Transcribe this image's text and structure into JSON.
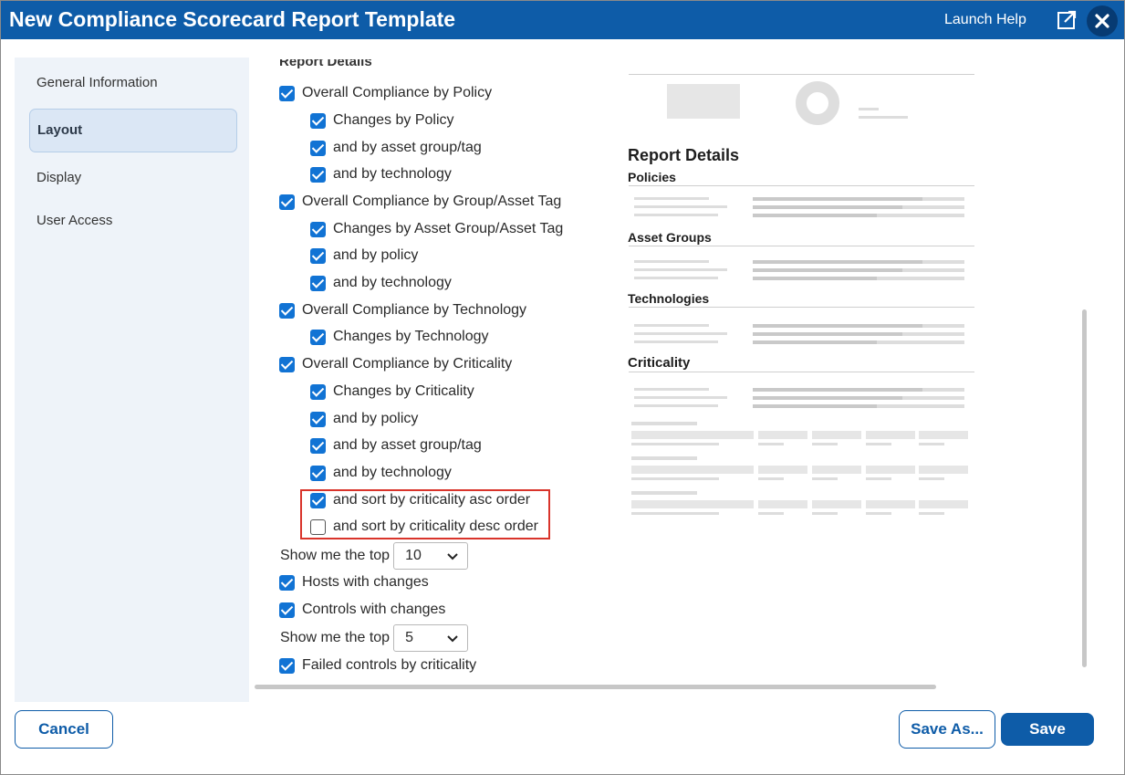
{
  "window": {
    "title": "New Compliance Scorecard Report Template",
    "help_link": "Launch Help"
  },
  "sidebar": {
    "items": [
      {
        "label": "General Information"
      },
      {
        "label": "Layout"
      },
      {
        "label": "Display"
      },
      {
        "label": "User Access"
      }
    ],
    "active": "Layout"
  },
  "report_details": {
    "section_title": "Report Details",
    "options": [
      {
        "label": "Overall Compliance by Policy",
        "checked": true
      },
      {
        "label": "Changes by Policy",
        "checked": true
      },
      {
        "label": "and by asset group/tag",
        "checked": true
      },
      {
        "label": "and by technology",
        "checked": true
      },
      {
        "label": "Overall Compliance by Group/Asset Tag",
        "checked": true
      },
      {
        "label": "Changes by Asset Group/Asset Tag",
        "checked": true
      },
      {
        "label": "and by policy",
        "checked": true
      },
      {
        "label": "and by technology",
        "checked": true
      },
      {
        "label": "Overall Compliance by Technology",
        "checked": true
      },
      {
        "label": "Changes by Technology",
        "checked": true
      },
      {
        "label": "Overall Compliance by Criticality",
        "checked": true
      },
      {
        "label": "Changes by Criticality",
        "checked": true
      },
      {
        "label": "and by policy",
        "checked": true
      },
      {
        "label": "and by asset group/tag",
        "checked": true
      },
      {
        "label": "and by technology",
        "checked": true
      },
      {
        "label": "and sort by criticality asc order",
        "checked": true
      },
      {
        "label": "and sort by criticality desc order",
        "checked": false
      }
    ],
    "top_hosts": {
      "label": "Show me the top",
      "value": "10"
    },
    "hosts_with_changes": {
      "label": "Hosts with changes",
      "checked": true
    },
    "controls_with_changes": {
      "label": "Controls with changes",
      "checked": true
    },
    "top_controls": {
      "label": "Show me the top",
      "value": "5"
    },
    "failed_controls": {
      "label": "Failed controls by criticality",
      "checked": true
    }
  },
  "preview": {
    "heading": "Report Details",
    "sections": [
      "Policies",
      "Asset Groups",
      "Technologies",
      "Criticality"
    ]
  },
  "footer": {
    "cancel": "Cancel",
    "save_as": "Save As...",
    "save": "Save"
  },
  "icons": {
    "popout": "popout-icon",
    "close": "close-icon",
    "checkbox_checked": "checkbox-checked-icon",
    "dropdown": "chevron-down-icon"
  },
  "colors": {
    "primary": "#0e5ca8",
    "checkbox": "#1173d4",
    "highlight": "#d9342b",
    "sidebar_bg": "#eef3f9"
  }
}
